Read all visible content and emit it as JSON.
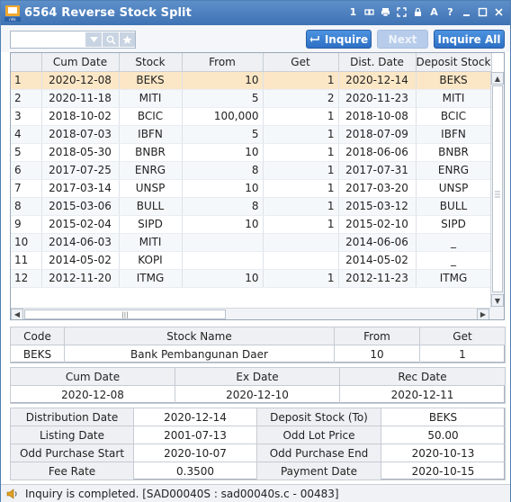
{
  "window": {
    "title": "6564 Reverse Stock Split",
    "title_icons": [
      "1",
      "link-icon",
      "print-icon",
      "expand-icon",
      "lock-icon",
      "A",
      "?",
      "minimize-icon",
      "maximize-icon",
      "close-icon"
    ]
  },
  "toolbar": {
    "stock_input_value": "",
    "inquire_label": "Inquire",
    "next_label": "Next",
    "inquire_all_label": "Inquire All"
  },
  "grid": {
    "columns": [
      "",
      "Cum Date",
      "Stock",
      "From",
      "Get",
      "Dist. Date",
      "Deposit Stock"
    ],
    "selected_row": 0,
    "rows": [
      {
        "no": "1",
        "cum_date": "2020-12-08",
        "stock": "BEKS",
        "from": "10",
        "get": "1",
        "dist_date": "2020-12-14",
        "deposit_stock": "BEKS"
      },
      {
        "no": "2",
        "cum_date": "2020-11-18",
        "stock": "MITI",
        "from": "5",
        "get": "2",
        "dist_date": "2020-11-23",
        "deposit_stock": "MITI"
      },
      {
        "no": "3",
        "cum_date": "2018-10-02",
        "stock": "BCIC",
        "from": "100,000",
        "get": "1",
        "dist_date": "2018-10-08",
        "deposit_stock": "BCIC"
      },
      {
        "no": "4",
        "cum_date": "2018-07-03",
        "stock": "IBFN",
        "from": "5",
        "get": "1",
        "dist_date": "2018-07-09",
        "deposit_stock": "IBFN"
      },
      {
        "no": "5",
        "cum_date": "2018-05-30",
        "stock": "BNBR",
        "from": "10",
        "get": "1",
        "dist_date": "2018-06-06",
        "deposit_stock": "BNBR"
      },
      {
        "no": "6",
        "cum_date": "2017-07-25",
        "stock": "ENRG",
        "from": "8",
        "get": "1",
        "dist_date": "2017-07-31",
        "deposit_stock": "ENRG"
      },
      {
        "no": "7",
        "cum_date": "2017-03-14",
        "stock": "UNSP",
        "from": "10",
        "get": "1",
        "dist_date": "2017-03-20",
        "deposit_stock": "UNSP"
      },
      {
        "no": "8",
        "cum_date": "2015-03-06",
        "stock": "BULL",
        "from": "8",
        "get": "1",
        "dist_date": "2015-03-12",
        "deposit_stock": "BULL"
      },
      {
        "no": "9",
        "cum_date": "2015-02-04",
        "stock": "SIPD",
        "from": "10",
        "get": "1",
        "dist_date": "2015-02-10",
        "deposit_stock": "SIPD"
      },
      {
        "no": "10",
        "cum_date": "2014-06-03",
        "stock": "MITI",
        "from": "",
        "get": "",
        "dist_date": "2014-06-06",
        "deposit_stock": "_"
      },
      {
        "no": "11",
        "cum_date": "2014-05-02",
        "stock": "KOPI",
        "from": "",
        "get": "",
        "dist_date": "2014-05-02",
        "deposit_stock": "_"
      },
      {
        "no": "12",
        "cum_date": "2012-11-20",
        "stock": "ITMG",
        "from": "10",
        "get": "1",
        "dist_date": "2012-11-23",
        "deposit_stock": "ITMG"
      }
    ]
  },
  "detail1": {
    "headers": [
      "Code",
      "Stock Name",
      "From",
      "Get"
    ],
    "values": [
      "BEKS",
      "Bank Pembangunan Daer",
      "10",
      "1"
    ]
  },
  "detail2": {
    "headers": [
      "Cum Date",
      "Ex Date",
      "Rec Date"
    ],
    "values": [
      "2020-12-08",
      "2020-12-10",
      "2020-12-11"
    ]
  },
  "detail3": {
    "rows": [
      [
        "Distribution Date",
        "2020-12-14",
        "Deposit Stock (To)",
        "BEKS"
      ],
      [
        "Listing Date",
        "2001-07-13",
        "Odd Lot Price",
        "50.00"
      ],
      [
        "Odd Purchase Start",
        "2020-10-07",
        "Odd Purchase End",
        "2020-10-13"
      ],
      [
        "Fee Rate",
        "0.3500",
        "Payment Date",
        "2020-10-15"
      ]
    ]
  },
  "status": {
    "message": "Inquiry is completed. [SAD00040S : sad00040s.c - 00483]"
  },
  "colors": {
    "title_bar": "#4a7dbf",
    "button_blue": "#3a7fd2",
    "selected_row": "#fbe7c6"
  }
}
